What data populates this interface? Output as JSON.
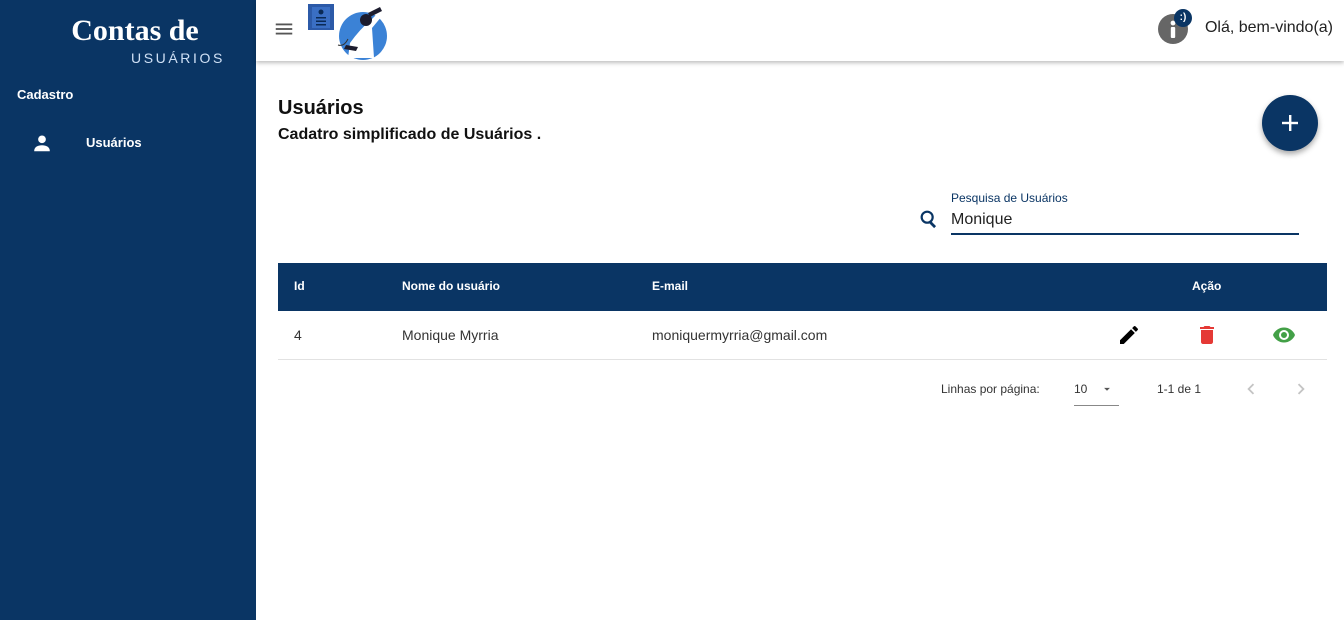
{
  "sidebar": {
    "brand_title": "Contas de",
    "brand_subtitle": "USUÁRIOS",
    "section_label": "Cadastro",
    "items": [
      {
        "label": "Usuários",
        "icon": "person-icon"
      }
    ],
    "background": "#0a3564"
  },
  "topbar": {
    "menu_icon": "menu-icon",
    "logo_icon": "user-avatar-illustration",
    "notification_badge": ":)",
    "greeting": "Olá, bem-vindo(a)"
  },
  "page": {
    "title": "Usuários",
    "subtitle": "Cadatro simplificado de Usuários .",
    "add_icon": "plus-icon"
  },
  "search": {
    "label": "Pesquisa de Usuários",
    "value": "Monique"
  },
  "table": {
    "columns": [
      "Id",
      "Nome do usuário",
      "E-mail",
      "Ação"
    ],
    "rows": [
      {
        "id": "4",
        "name": "Monique Myrria",
        "email": "moniquermyrria@gmail.com"
      }
    ],
    "action_icons": [
      "edit-icon",
      "delete-icon",
      "view-icon"
    ],
    "action_colors": {
      "edit": "#000000",
      "delete": "#e53935",
      "view": "#43a047"
    }
  },
  "pagination": {
    "rows_per_page_label": "Linhas por página:",
    "rows_per_page": "10",
    "range": "1-1 de 1"
  },
  "colors": {
    "primary": "#0a3564"
  }
}
